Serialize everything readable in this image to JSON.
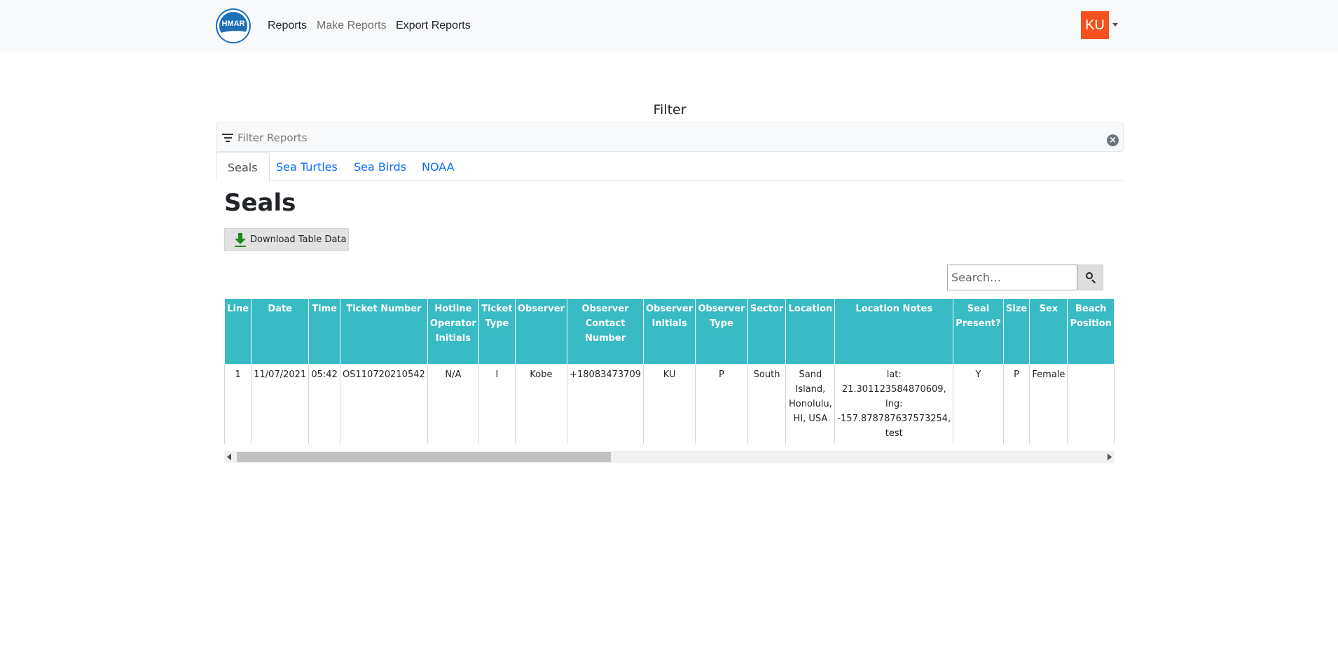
{
  "navbar": {
    "logo_text": "HMAR",
    "links": [
      {
        "label": "Reports"
      },
      {
        "label": "Make Reports"
      },
      {
        "label": "Export Reports"
      }
    ],
    "avatar_initials": "KU"
  },
  "filter": {
    "title": "Filter",
    "placeholder": "Filter Reports"
  },
  "tabs": [
    {
      "label": "Seals",
      "active": true
    },
    {
      "label": "Sea Turtles"
    },
    {
      "label": "Sea Birds"
    },
    {
      "label": "NOAA"
    }
  ],
  "page": {
    "title": "Seals",
    "download_label": "Download Table Data",
    "search_placeholder": "Search…"
  },
  "table": {
    "columns": [
      "Line",
      "Date",
      "Time",
      "Ticket Number",
      "Hotline Operator Initials",
      "Ticket Type",
      "Observer",
      "Observer Contact Number",
      "Observer Initials",
      "Observer Type",
      "Sector",
      "Location",
      "Location Notes",
      "Seal Present?",
      "Size",
      "Sex",
      "Beach Position"
    ],
    "rows": [
      [
        "1",
        "11/07/2021",
        "05:42",
        "OS110720210542",
        "N/A",
        "I",
        "Kobe",
        "+18083473709",
        "KU",
        "P",
        "South",
        "Sand Island, Honolulu, HI, USA",
        "lat: 21.301123584870609, lng: -157.878787637573254, test",
        "Y",
        "P",
        "Female",
        ""
      ]
    ]
  },
  "colors": {
    "header_bg": "#38bbc4",
    "avatar_bg": "#f4511e",
    "link": "#0d6efd",
    "download_icon": "#1a8a1a"
  }
}
